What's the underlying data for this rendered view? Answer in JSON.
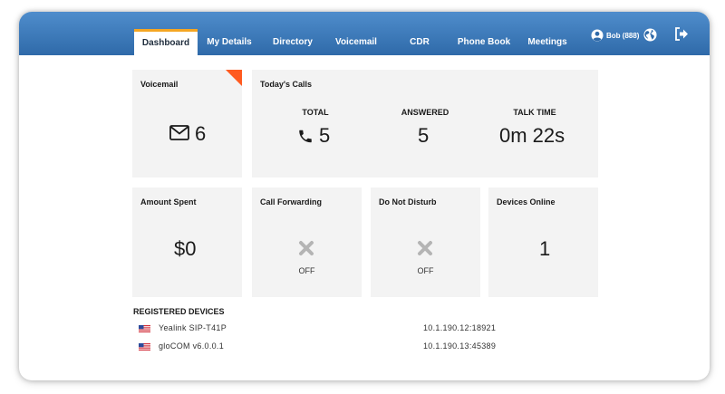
{
  "nav": {
    "tabs": [
      {
        "label": "Dashboard",
        "active": true
      },
      {
        "label": "My Details"
      },
      {
        "label": "Directory"
      },
      {
        "label": "Voicemail"
      },
      {
        "label": "CDR"
      },
      {
        "label": "Phone Book"
      },
      {
        "label": "Meetings"
      }
    ],
    "user": "Bob (888)",
    "icons": [
      "user-avatar-icon",
      "globe-icon",
      "logout-icon"
    ]
  },
  "colors": {
    "header_top": "#4f8dcc",
    "header_bottom": "#2f6aa9",
    "active_tab_accent": "#f5a623",
    "voicemail_corner": "#ff5a1f",
    "card_bg": "#f3f3f3"
  },
  "voicemail": {
    "title": "Voicemail",
    "count": "6",
    "icon": "envelope-icon"
  },
  "todays_calls": {
    "title": "Today's Calls",
    "total_label": "TOTAL",
    "total": "5",
    "answered_label": "ANSWERED",
    "answered": "5",
    "talk_time_label": "TALK TIME",
    "talk_time": "0m 22s"
  },
  "amount_spent": {
    "title": "Amount Spent",
    "value": "$0"
  },
  "call_forwarding": {
    "title": "Call Forwarding",
    "status": "OFF"
  },
  "do_not_disturb": {
    "title": "Do Not Disturb",
    "status": "OFF"
  },
  "devices_online": {
    "title": "Devices Online",
    "value": "1"
  },
  "registered_devices": {
    "title": "REGISTERED DEVICES",
    "items": [
      {
        "name": "Yealink SIP-T41P",
        "address": "10.1.190.12:18921"
      },
      {
        "name": "gloCOM v6.0.0.1",
        "address": "10.1.190.13:45389"
      }
    ]
  }
}
